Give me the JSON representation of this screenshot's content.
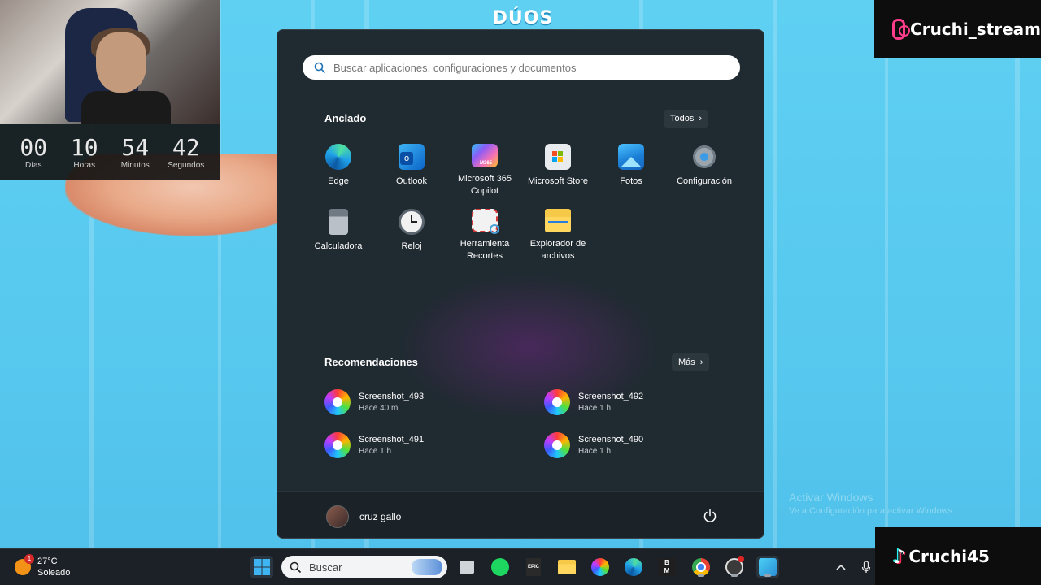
{
  "background": {
    "game_title": "DÚOS",
    "watermark": {
      "line1": "Activar Windows",
      "line2": "Ve a Configuración para activar Windows."
    }
  },
  "countdown": {
    "cells": [
      {
        "value": "00",
        "label": "Días"
      },
      {
        "value": "10",
        "label": "Horas"
      },
      {
        "value": "54",
        "label": "Minutos"
      },
      {
        "value": "42",
        "label": "Segundos"
      }
    ]
  },
  "socials": {
    "instagram": "Cruchi_stream",
    "tiktok": "Cruchi45"
  },
  "start_menu": {
    "search_placeholder": "Buscar aplicaciones, configuraciones y documentos",
    "pinned_title": "Anclado",
    "pinned_more": "Todos",
    "pinned": [
      {
        "label": "Edge",
        "icon": "edge-icon"
      },
      {
        "label": "Outlook",
        "icon": "outlook-icon"
      },
      {
        "label": "Microsoft 365 Copilot",
        "icon": "m365-icon"
      },
      {
        "label": "Microsoft Store",
        "icon": "store-icon"
      },
      {
        "label": "Fotos",
        "icon": "photos-icon"
      },
      {
        "label": "Configuración",
        "icon": "settings-icon"
      },
      {
        "label": "Calculadora",
        "icon": "calculator-icon"
      },
      {
        "label": "Reloj",
        "icon": "clock-icon"
      },
      {
        "label": "Herramienta Recortes",
        "icon": "snipping-tool-icon"
      },
      {
        "label": "Explorador de archivos",
        "icon": "file-explorer-icon"
      }
    ],
    "recs_title": "Recomendaciones",
    "recs_more": "Más",
    "recommendations": [
      {
        "name": "Screenshot_493",
        "time": "Hace 40 m"
      },
      {
        "name": "Screenshot_492",
        "time": "Hace 1 h"
      },
      {
        "name": "Screenshot_491",
        "time": "Hace 1 h"
      },
      {
        "name": "Screenshot_490",
        "time": "Hace 1 h"
      }
    ],
    "user_name": "cruz gallo"
  },
  "taskbar": {
    "weather_temp": "27°C",
    "weather_desc": "Soleado",
    "weather_badge": "1",
    "search_placeholder": "Buscar",
    "epic_label": "EPIC",
    "bm_label": "B\nM"
  }
}
